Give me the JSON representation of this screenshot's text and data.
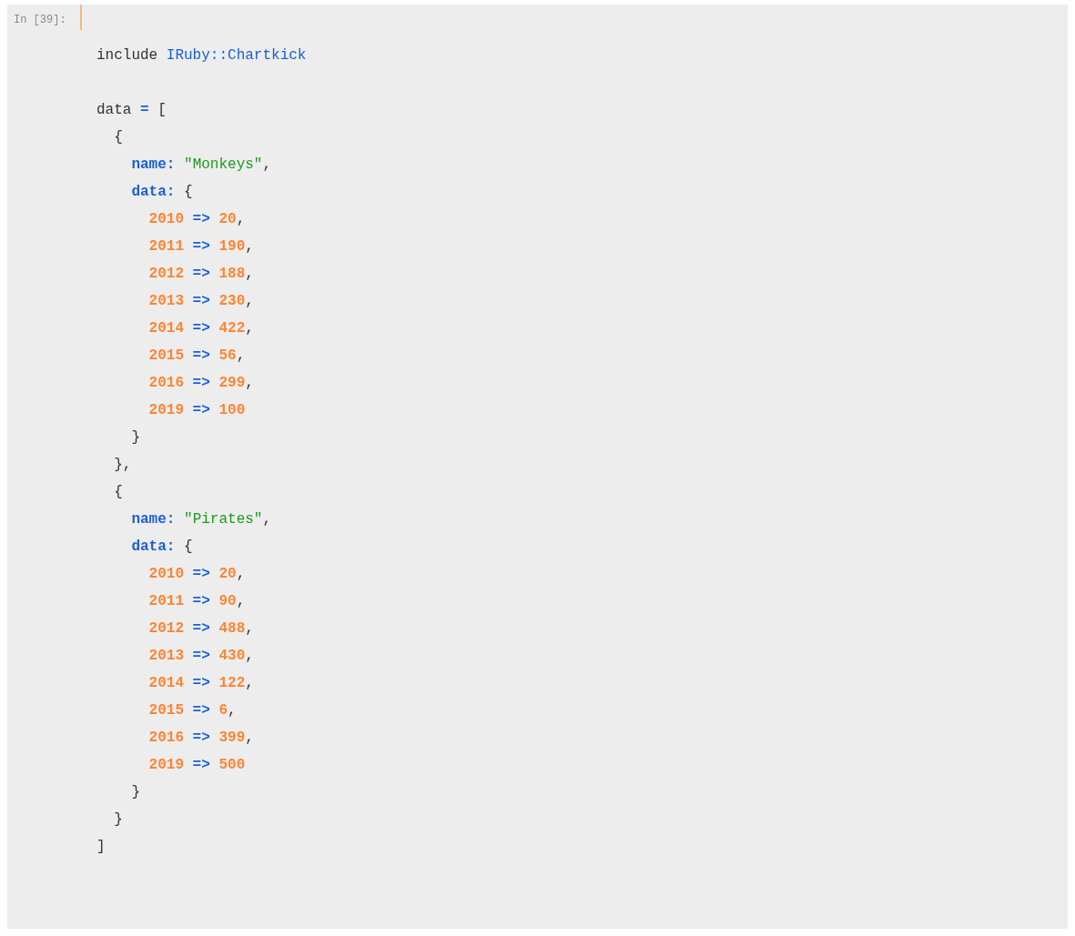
{
  "cell": {
    "prompt": "In [39]:",
    "lines": [
      {
        "kind": "code",
        "tokens": [
          {
            "text": "include ",
            "kind": "plain"
          },
          {
            "text": "IRuby::Chartkick",
            "kind": "constant"
          }
        ]
      },
      {
        "kind": "blank"
      },
      {
        "kind": "code",
        "tokens": [
          {
            "text": "data ",
            "kind": "plain"
          },
          {
            "text": "=",
            "kind": "operator"
          },
          {
            "text": " [",
            "kind": "plain"
          }
        ]
      },
      {
        "kind": "code",
        "tokens": [
          {
            "text": "  {",
            "kind": "plain"
          }
        ]
      },
      {
        "kind": "code",
        "tokens": [
          {
            "text": "    name:",
            "kind": "symbol"
          },
          {
            "text": " \"Monkeys\"",
            "kind": "string"
          },
          {
            "text": ",",
            "kind": "plain"
          }
        ]
      },
      {
        "kind": "code",
        "tokens": [
          {
            "text": "    data:",
            "kind": "symbol"
          },
          {
            "text": " {",
            "kind": "plain"
          }
        ]
      },
      {
        "kind": "code",
        "tokens": [
          {
            "text": "      2010",
            "kind": "number"
          },
          {
            "text": " =>",
            "kind": "operator"
          },
          {
            "text": " 20",
            "kind": "number"
          },
          {
            "text": ",",
            "kind": "plain"
          }
        ]
      },
      {
        "kind": "code",
        "tokens": [
          {
            "text": "      2011",
            "kind": "number"
          },
          {
            "text": " =>",
            "kind": "operator"
          },
          {
            "text": " 190",
            "kind": "number"
          },
          {
            "text": ",",
            "kind": "plain"
          }
        ]
      },
      {
        "kind": "code",
        "tokens": [
          {
            "text": "      2012",
            "kind": "number"
          },
          {
            "text": " =>",
            "kind": "operator"
          },
          {
            "text": " 188",
            "kind": "number"
          },
          {
            "text": ",",
            "kind": "plain"
          }
        ]
      },
      {
        "kind": "code",
        "tokens": [
          {
            "text": "      2013",
            "kind": "number"
          },
          {
            "text": " =>",
            "kind": "operator"
          },
          {
            "text": " 230",
            "kind": "number"
          },
          {
            "text": ",",
            "kind": "plain"
          }
        ]
      },
      {
        "kind": "code",
        "tokens": [
          {
            "text": "      2014",
            "kind": "number"
          },
          {
            "text": " =>",
            "kind": "operator"
          },
          {
            "text": " 422",
            "kind": "number"
          },
          {
            "text": ",",
            "kind": "plain"
          }
        ]
      },
      {
        "kind": "code",
        "tokens": [
          {
            "text": "      2015",
            "kind": "number"
          },
          {
            "text": " =>",
            "kind": "operator"
          },
          {
            "text": " 56",
            "kind": "number"
          },
          {
            "text": ",",
            "kind": "plain"
          }
        ]
      },
      {
        "kind": "code",
        "tokens": [
          {
            "text": "      2016",
            "kind": "number"
          },
          {
            "text": " =>",
            "kind": "operator"
          },
          {
            "text": " 299",
            "kind": "number"
          },
          {
            "text": ",",
            "kind": "plain"
          }
        ]
      },
      {
        "kind": "code",
        "tokens": [
          {
            "text": "      2019",
            "kind": "number"
          },
          {
            "text": " =>",
            "kind": "operator"
          },
          {
            "text": " 100",
            "kind": "number"
          }
        ]
      },
      {
        "kind": "code",
        "tokens": [
          {
            "text": "    }",
            "kind": "plain"
          }
        ]
      },
      {
        "kind": "code",
        "tokens": [
          {
            "text": "  },",
            "kind": "plain"
          }
        ]
      },
      {
        "kind": "code",
        "tokens": [
          {
            "text": "  {",
            "kind": "plain"
          }
        ]
      },
      {
        "kind": "code",
        "tokens": [
          {
            "text": "    name:",
            "kind": "symbol"
          },
          {
            "text": " \"Pirates\"",
            "kind": "string"
          },
          {
            "text": ",",
            "kind": "plain"
          }
        ]
      },
      {
        "kind": "code",
        "tokens": [
          {
            "text": "    data:",
            "kind": "symbol"
          },
          {
            "text": " {",
            "kind": "plain"
          }
        ]
      },
      {
        "kind": "code",
        "tokens": [
          {
            "text": "      2010",
            "kind": "number"
          },
          {
            "text": " =>",
            "kind": "operator"
          },
          {
            "text": " 20",
            "kind": "number"
          },
          {
            "text": ",",
            "kind": "plain"
          }
        ]
      },
      {
        "kind": "code",
        "tokens": [
          {
            "text": "      2011",
            "kind": "number"
          },
          {
            "text": " =>",
            "kind": "operator"
          },
          {
            "text": " 90",
            "kind": "number"
          },
          {
            "text": ",",
            "kind": "plain"
          }
        ]
      },
      {
        "kind": "code",
        "tokens": [
          {
            "text": "      2012",
            "kind": "number"
          },
          {
            "text": " =>",
            "kind": "operator"
          },
          {
            "text": " 488",
            "kind": "number"
          },
          {
            "text": ",",
            "kind": "plain"
          }
        ]
      },
      {
        "kind": "code",
        "tokens": [
          {
            "text": "      2013",
            "kind": "number"
          },
          {
            "text": " =>",
            "kind": "operator"
          },
          {
            "text": " 430",
            "kind": "number"
          },
          {
            "text": ",",
            "kind": "plain"
          }
        ]
      },
      {
        "kind": "code",
        "tokens": [
          {
            "text": "      2014",
            "kind": "number"
          },
          {
            "text": " =>",
            "kind": "operator"
          },
          {
            "text": " 122",
            "kind": "number"
          },
          {
            "text": ",",
            "kind": "plain"
          }
        ]
      },
      {
        "kind": "code",
        "tokens": [
          {
            "text": "      2015",
            "kind": "number"
          },
          {
            "text": " =>",
            "kind": "operator"
          },
          {
            "text": " 6",
            "kind": "number"
          },
          {
            "text": ",",
            "kind": "plain"
          }
        ]
      },
      {
        "kind": "code",
        "tokens": [
          {
            "text": "      2016",
            "kind": "number"
          },
          {
            "text": " =>",
            "kind": "operator"
          },
          {
            "text": " 399",
            "kind": "number"
          },
          {
            "text": ",",
            "kind": "plain"
          }
        ]
      },
      {
        "kind": "code",
        "tokens": [
          {
            "text": "      2019",
            "kind": "number"
          },
          {
            "text": " =>",
            "kind": "operator"
          },
          {
            "text": " 500",
            "kind": "number"
          }
        ]
      },
      {
        "kind": "code",
        "tokens": [
          {
            "text": "    }",
            "kind": "plain"
          }
        ]
      },
      {
        "kind": "code",
        "tokens": [
          {
            "text": "  }",
            "kind": "plain"
          }
        ]
      },
      {
        "kind": "code",
        "tokens": [
          {
            "text": "]",
            "kind": "plain"
          }
        ]
      }
    ]
  }
}
